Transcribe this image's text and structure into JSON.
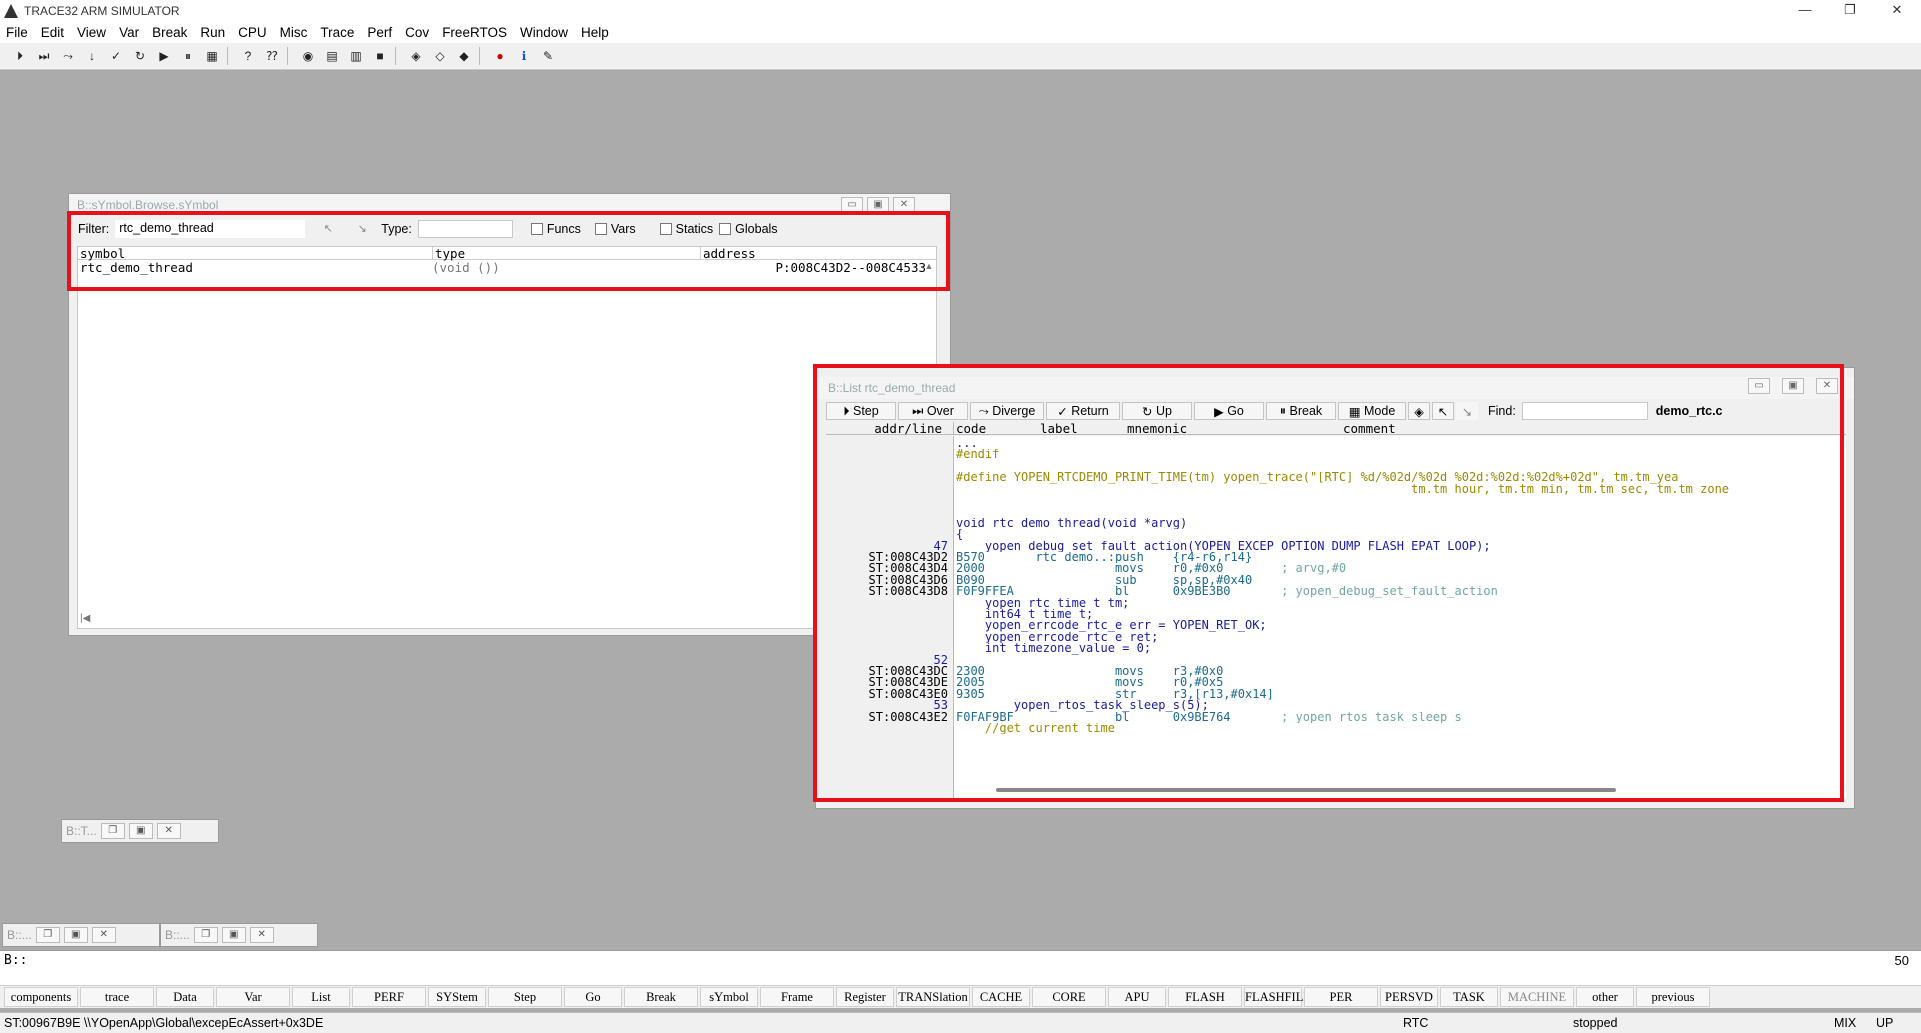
{
  "app": {
    "title": "TRACE32 ARM SIMULATOR"
  },
  "menu": [
    "File",
    "Edit",
    "View",
    "Var",
    "Break",
    "Run",
    "CPU",
    "Misc",
    "Trace",
    "Perf",
    "Cov",
    "FreeRTOS",
    "Window",
    "Help"
  ],
  "symbol_window": {
    "title": "B::sYmbol.Browse.sYmbol",
    "filter_label": "Filter:",
    "filter_value": "rtc_demo_thread",
    "type_label": "Type:",
    "type_value": "",
    "checkboxes": [
      "Funcs",
      "Vars",
      "Statics",
      "Globals"
    ],
    "headers": {
      "symbol": "symbol",
      "type": "type",
      "address": "address"
    },
    "row": {
      "symbol": "rtc_demo_thread",
      "type": "(void ())",
      "address": "P:008C43D2--008C4533"
    }
  },
  "list_window": {
    "title": "B::List rtc_demo_thread",
    "buttons": [
      "Step",
      "Over",
      "Diverge",
      "Return",
      "Up",
      "Go",
      "Break",
      "Mode"
    ],
    "find_label": "Find:",
    "find_value": "",
    "file": "demo_rtc.c",
    "headers": {
      "addr": "addr/line",
      "code": "code",
      "label": "label",
      "mnemonic": "mnemonic",
      "comment": "comment"
    },
    "lines": [
      {
        "addr": "",
        "code": "...",
        "src": ""
      },
      {
        "addr": "",
        "code": "#endif",
        "src": ""
      },
      {
        "addr": "",
        "code": "",
        "src": ""
      },
      {
        "addr": "",
        "code": "#define YOPEN_RTCDEMO_PRINT_TIME(tm) yopen_trace(\"[RTC] %d/%02d/%02d %02d:%02d:%02d%+02d\", tm.tm_yea",
        "src": ""
      },
      {
        "addr": "",
        "code": "                                                               tm.tm_hour, tm.tm_min, tm.tm_sec, tm.tm_zone",
        "src": ""
      },
      {
        "addr": "",
        "code": "",
        "src": ""
      },
      {
        "addr": "",
        "code": "",
        "src": ""
      },
      {
        "addr": "",
        "code": "void rtc_demo_thread(void *arvg)",
        "src": ""
      },
      {
        "addr": "",
        "code": "{",
        "src": ""
      },
      {
        "addr": "47",
        "code": "    yopen_debug_set_fault_action(YOPEN_EXCEP_OPTION_DUMP_FLASH_EPAT_LOOP);",
        "src": ""
      },
      {
        "addr": "ST:008C43D2",
        "code": "B570       rtc_demo..:push    {r4-r6,r14}",
        "src": ""
      },
      {
        "addr": "ST:008C43D4",
        "code": "2000                  movs    r0,#0x0        ; arvg,#0",
        "src": ""
      },
      {
        "addr": "ST:008C43D6",
        "code": "B090                  sub     sp,sp,#0x40",
        "src": ""
      },
      {
        "addr": "ST:008C43D8",
        "code": "F0F9FFEA              bl      0x9BE3B0       ; yopen_debug_set_fault_action",
        "src": ""
      },
      {
        "addr": "",
        "code": "    yopen_rtc_time_t tm;",
        "src": ""
      },
      {
        "addr": "",
        "code": "    int64_t time_t;",
        "src": ""
      },
      {
        "addr": "",
        "code": "    yopen_errcode_rtc_e err = YOPEN_RET_OK;",
        "src": ""
      },
      {
        "addr": "",
        "code": "    yopen_errcode_rtc_e ret;",
        "src": ""
      },
      {
        "addr": "",
        "code": "    int timezone_value = 0;",
        "src": ""
      },
      {
        "addr": "52",
        "code": "",
        "src": ""
      },
      {
        "addr": "ST:008C43DC",
        "code": "2300                  movs    r3,#0x0",
        "src": ""
      },
      {
        "addr": "ST:008C43DE",
        "code": "2005                  movs    r0,#0x5",
        "src": ""
      },
      {
        "addr": "ST:008C43E0",
        "code": "9305                  str     r3,[r13,#0x14]",
        "src": ""
      },
      {
        "addr": "53",
        "code": "        yopen_rtos_task_sleep_s(5);",
        "src": ""
      },
      {
        "addr": "ST:008C43E2",
        "code": "F0FAF9BF              bl      0x9BE764       ; yopen_rtos_task_sleep_s",
        "src": ""
      },
      {
        "addr": "",
        "code": "    //get current time",
        "src": ""
      }
    ]
  },
  "mini_windows": [
    "B::T...",
    "B::...",
    "B::..."
  ],
  "cmd": {
    "prompt": "B::",
    "value": "",
    "count": "50"
  },
  "softkeys": [
    "components",
    "trace",
    "Data",
    "Var",
    "List",
    "PERF",
    "SYStem",
    "Step",
    "Go",
    "Break",
    "sYmbol",
    "Frame",
    "Register",
    "TRANSlation",
    "CACHE",
    "CORE",
    "APU",
    "FLASH",
    "FLASHFILE",
    "PER",
    "PERSVD",
    "TASK",
    "MACHINE",
    "other",
    "previous"
  ],
  "status": {
    "pc": "ST:00967B9E  \\\\YOpenApp\\Global\\excepEcAssert+0x3DE",
    "mode": "RTC",
    "state": "stopped",
    "mix": "MIX",
    "up": "UP"
  },
  "colors": {
    "highlight": "#e8101a",
    "accent_blue": "#1a1aa0",
    "comment_green": "#6fa7a0",
    "olive": "#9c8a00"
  }
}
